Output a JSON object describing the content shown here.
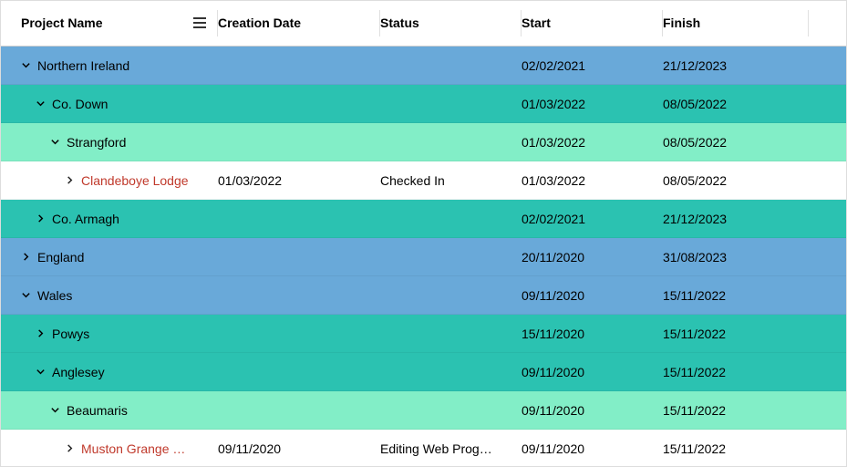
{
  "columns": {
    "name": "Project Name",
    "creation": "Creation Date",
    "status": "Status",
    "start": "Start",
    "finish": "Finish"
  },
  "rows": [
    {
      "level": 0,
      "expanded": true,
      "name": "Northern Ireland",
      "creation": "",
      "status": "",
      "start": "02/02/2021",
      "finish": "21/12/2023"
    },
    {
      "level": 1,
      "expanded": true,
      "name": "Co. Down",
      "creation": "",
      "status": "",
      "start": "01/03/2022",
      "finish": "08/05/2022"
    },
    {
      "level": 2,
      "expanded": true,
      "name": "Strangford",
      "creation": "",
      "status": "",
      "start": "01/03/2022",
      "finish": "08/05/2022"
    },
    {
      "level": 3,
      "leaf": true,
      "name": "Clandeboye Lodge",
      "creation": "01/03/2022",
      "status": "Checked In",
      "start": "01/03/2022",
      "finish": "08/05/2022"
    },
    {
      "level": 1,
      "expanded": false,
      "name": "Co. Armagh",
      "creation": "",
      "status": "",
      "start": "02/02/2021",
      "finish": "21/12/2023"
    },
    {
      "level": 0,
      "expanded": false,
      "name": "England",
      "creation": "",
      "status": "",
      "start": "20/11/2020",
      "finish": "31/08/2023"
    },
    {
      "level": 0,
      "expanded": true,
      "name": "Wales",
      "creation": "",
      "status": "",
      "start": "09/11/2020",
      "finish": "15/11/2022"
    },
    {
      "level": 1,
      "expanded": false,
      "name": "Powys",
      "creation": "",
      "status": "",
      "start": "15/11/2020",
      "finish": "15/11/2022"
    },
    {
      "level": 1,
      "expanded": true,
      "name": "Anglesey",
      "creation": "",
      "status": "",
      "start": "09/11/2020",
      "finish": "15/11/2022"
    },
    {
      "level": 2,
      "expanded": true,
      "name": "Beaumaris",
      "creation": "",
      "status": "",
      "start": "09/11/2020",
      "finish": "15/11/2022"
    },
    {
      "level": 3,
      "leaf": true,
      "name": "Muston Grange …",
      "creation": "09/11/2020",
      "status": "Editing Web Prog…",
      "start": "09/11/2020",
      "finish": "15/11/2022"
    }
  ]
}
